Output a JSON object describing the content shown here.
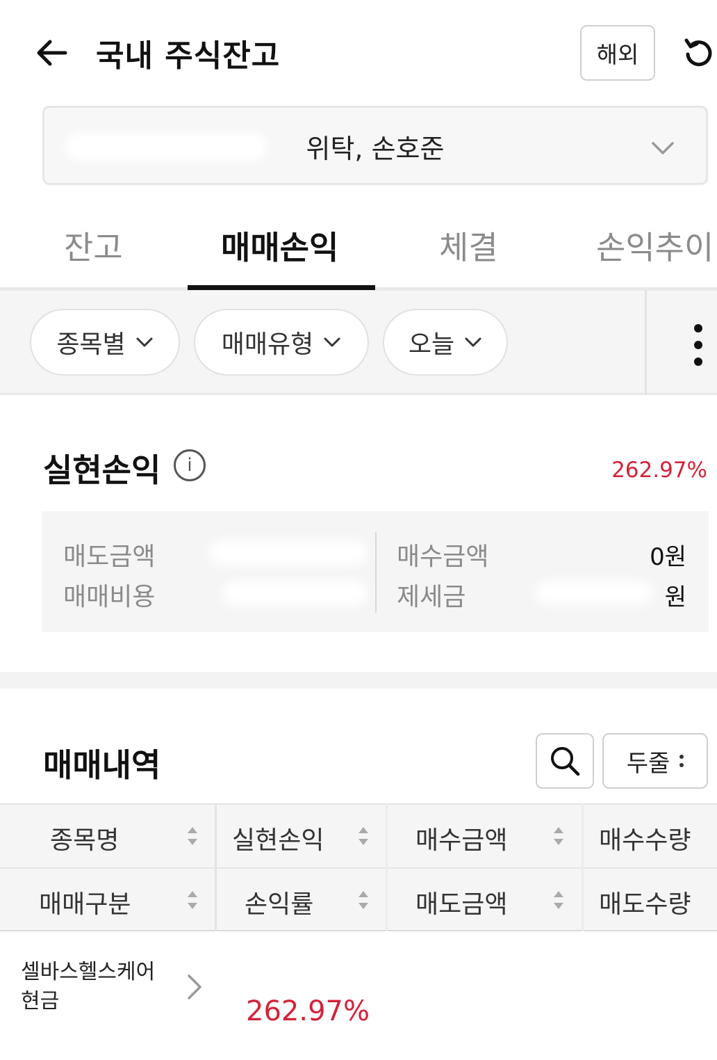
{
  "header": {
    "title": "국내 주식잔고",
    "overseas_label": "해외",
    "back_icon": "arrow-left-icon",
    "refresh_icon": "refresh-icon"
  },
  "account": {
    "name": "위탁, 손호준"
  },
  "tabs": [
    {
      "label": "잔고",
      "active": false
    },
    {
      "label": "매매손익",
      "active": true
    },
    {
      "label": "체결",
      "active": false
    },
    {
      "label": "손익추이",
      "active": false
    }
  ],
  "filters": [
    {
      "label": "종목별"
    },
    {
      "label": "매매유형"
    },
    {
      "label": "오늘"
    }
  ],
  "realized": {
    "title": "실현손익",
    "rate": "262.97%",
    "sell_amount_label": "매도금액",
    "trade_cost_label": "매매비용",
    "buy_amount_label": "매수금액",
    "buy_amount_value": "0원",
    "tax_label": "제세금",
    "tax_value": "원"
  },
  "history": {
    "title": "매매내역",
    "tworow_label": "두줄",
    "columns_row1": [
      "종목명",
      "실현손익",
      "매수금액",
      "매수수량"
    ],
    "columns_row2": [
      "매매구분",
      "손익률",
      "매도금액",
      "매도수량"
    ],
    "rows": [
      {
        "name": "셀바스헬스케어",
        "type": "현금",
        "rate": "262.97%"
      }
    ]
  },
  "colors": {
    "accent_red": "#d3233a",
    "tab_active": "#111111"
  }
}
